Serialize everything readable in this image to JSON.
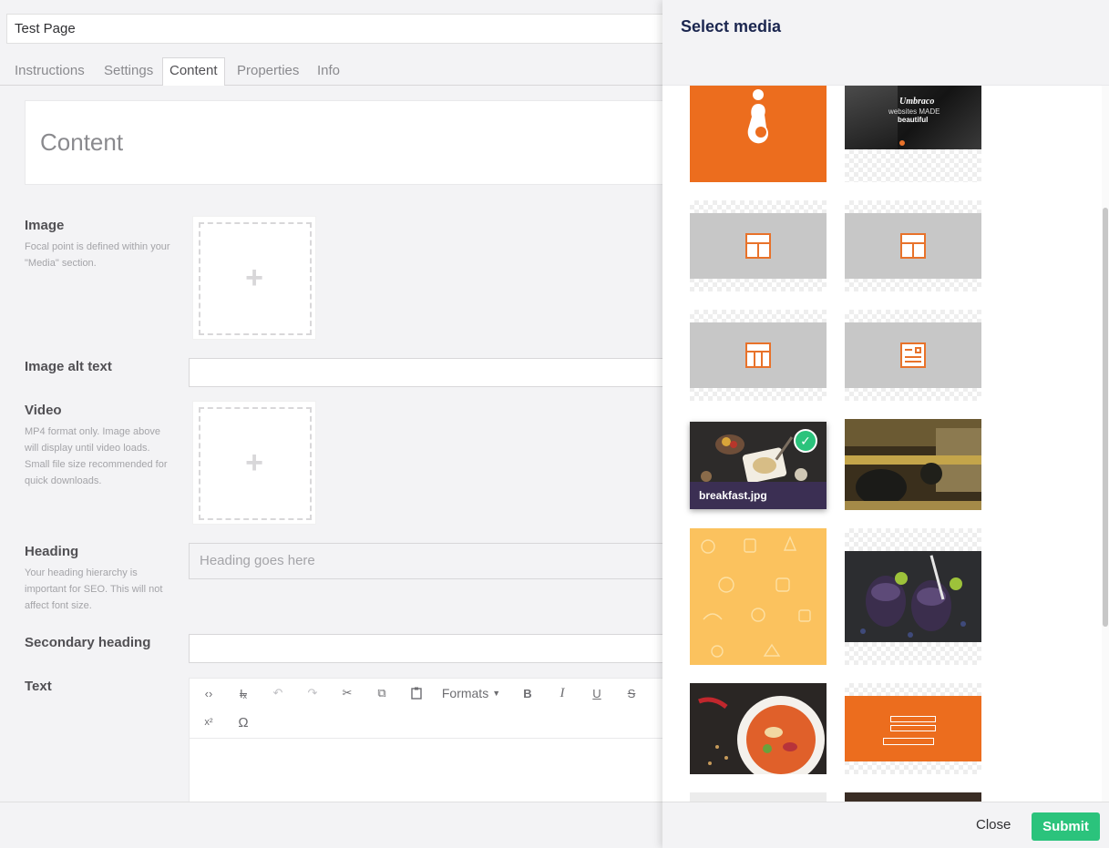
{
  "editor": {
    "page_name": "Test Page",
    "tabs": [
      {
        "label": "Instructions"
      },
      {
        "label": "Settings"
      },
      {
        "label": "Content"
      },
      {
        "label": "Properties"
      },
      {
        "label": "Info"
      }
    ],
    "active_tab": "Content",
    "group_title": "Content",
    "properties": {
      "image": {
        "label": "Image",
        "description": "Focal point is defined within your \"Media\" section."
      },
      "image_alt": {
        "label": "Image alt text"
      },
      "video": {
        "label": "Video",
        "description": "MP4 format only. Image above will display until video loads. Small file size recommended for quick downloads."
      },
      "heading": {
        "label": "Heading",
        "description": "Your heading hierarchy is important for SEO. This will not affect font size.",
        "placeholder": "Heading goes here"
      },
      "secondary_heading": {
        "label": "Secondary heading"
      },
      "text": {
        "label": "Text"
      }
    },
    "rte_toolbar": {
      "formats_label": "Formats",
      "buttons": [
        "code-icon",
        "clear-format-icon",
        "undo-icon",
        "redo-icon",
        "cut-icon",
        "copy-icon",
        "paste-icon",
        "bold-icon",
        "italic-icon",
        "underline-icon",
        "strikethrough-icon",
        "superscript-icon",
        "omega-icon"
      ],
      "glyphs": {
        "code": "‹›",
        "clear": "I̶ₓ",
        "undo": "↶",
        "redo": "↷",
        "cut": "✂",
        "copy": "⧉",
        "paste": "📋",
        "bold": "B",
        "italic": "I",
        "underline": "U",
        "strike": "S",
        "super": "x²",
        "omega": "Ω"
      }
    }
  },
  "media_picker": {
    "title": "Select media",
    "close_label": "Close",
    "submit_label": "Submit",
    "items": [
      {
        "kind": "orange-logo",
        "selected": false
      },
      {
        "kind": "umbraco-photo",
        "text_line1": "Umbraco",
        "text_line2": "websites MADE",
        "text_line3": "beautiful",
        "selected": false
      },
      {
        "kind": "layout-icon",
        "selected": false
      },
      {
        "kind": "layout-icon",
        "selected": false
      },
      {
        "kind": "columns-icon",
        "selected": false
      },
      {
        "kind": "article-icon",
        "selected": false
      },
      {
        "kind": "photo-breakfast",
        "name": "breakfast.jpg",
        "selected": true
      },
      {
        "kind": "photo-bar",
        "selected": false
      },
      {
        "kind": "yellow-pattern",
        "selected": false
      },
      {
        "kind": "photo-drinks",
        "selected": false
      },
      {
        "kind": "photo-soup",
        "selected": false
      },
      {
        "kind": "orange-form",
        "selected": false
      }
    ],
    "colors": {
      "accent_orange": "#e8722a",
      "submit_green": "#2bc37c",
      "label_purple": "#3b2f53",
      "placeholder_grey": "#c7c7c7",
      "yellow": "#fbc25e"
    }
  }
}
